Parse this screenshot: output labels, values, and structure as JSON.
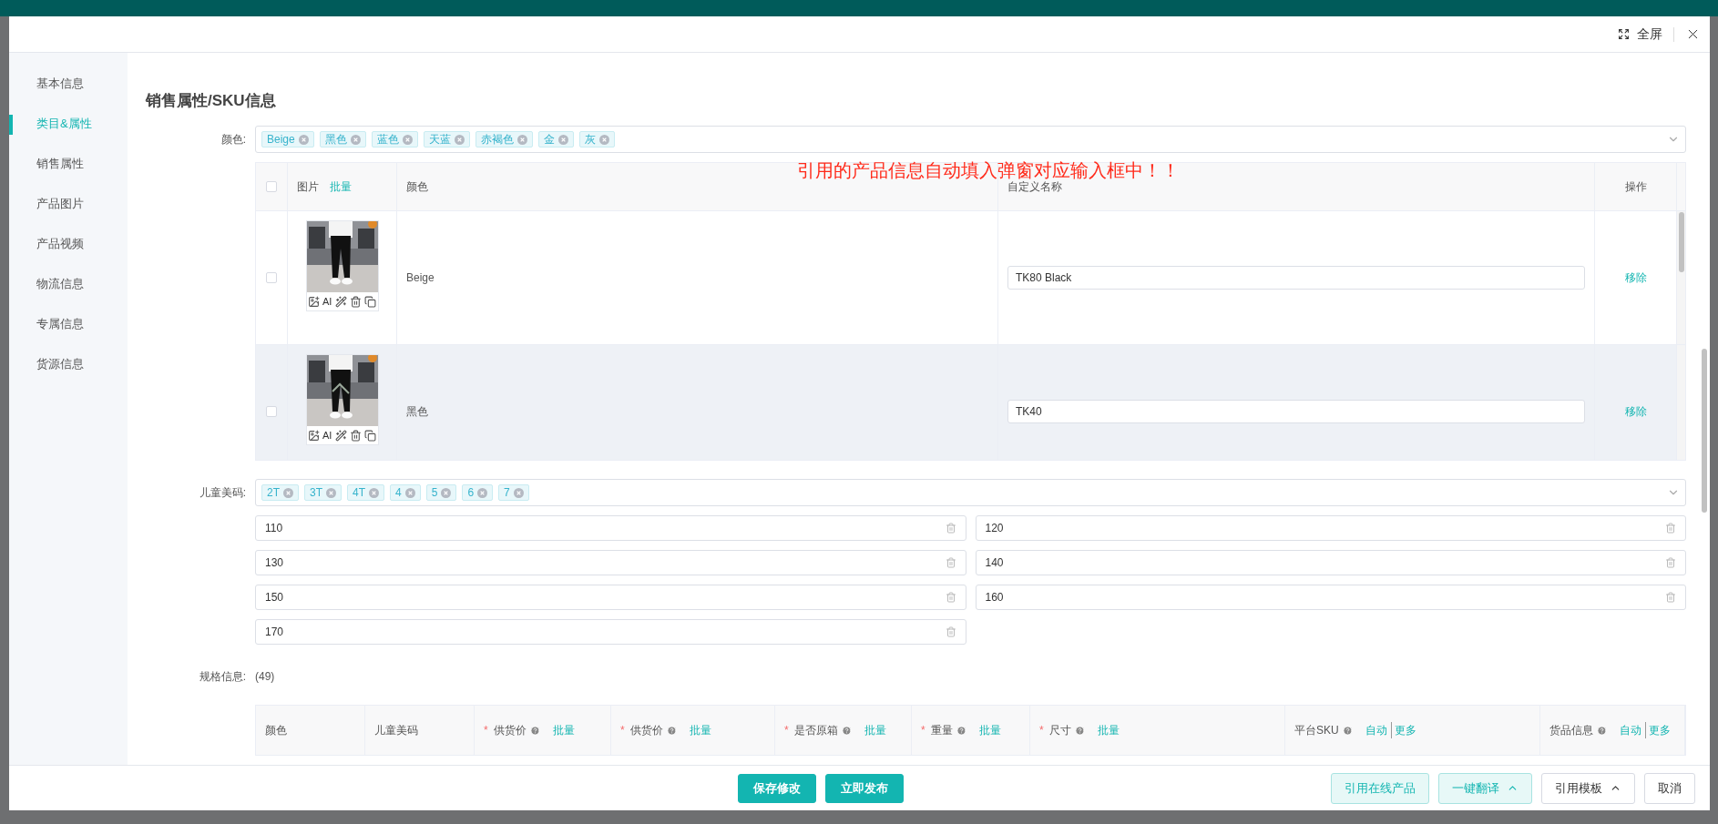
{
  "dialog": {
    "fullscreen_label": "全屏"
  },
  "sidebar": {
    "items": [
      {
        "label": "基本信息",
        "selected": false
      },
      {
        "label": "类目&属性",
        "selected": true
      },
      {
        "label": "销售属性",
        "selected": false
      },
      {
        "label": "产品图片",
        "selected": false
      },
      {
        "label": "产品视频",
        "selected": false
      },
      {
        "label": "物流信息",
        "selected": false
      },
      {
        "label": "专属信息",
        "selected": false
      },
      {
        "label": "货源信息",
        "selected": false
      }
    ]
  },
  "section_title": "销售属性/SKU信息",
  "annotation": "引用的产品信息自动填入弹窗对应输入框中！！",
  "color_field": {
    "label": "颜色:",
    "tags": [
      "Beige",
      "黑色",
      "蓝色",
      "天蓝",
      "赤褐色",
      "金",
      "灰"
    ]
  },
  "color_table": {
    "all_checked": false,
    "image_column": "图片",
    "batch_link": "批量",
    "color_column": "颜色",
    "name_column": "自定义名称",
    "action_column": "操作",
    "rows": [
      {
        "checked": false,
        "ai_label": "AI",
        "color_value": "Beige",
        "custom_name": "TK80 Black",
        "action": "移除",
        "selected": false
      },
      {
        "checked": false,
        "ai_label": "AI",
        "color_value": "黑色",
        "custom_name": "TK40",
        "action": "移除",
        "selected": true
      }
    ]
  },
  "kids_size": {
    "label": "儿童美码:",
    "tags": [
      "2T",
      "3T",
      "4T",
      "4",
      "5",
      "6",
      "7"
    ],
    "values": [
      "110",
      "120",
      "130",
      "140",
      "150",
      "160",
      "170"
    ]
  },
  "spec": {
    "label": "规格信息:",
    "count": "(49)",
    "columns": [
      {
        "label": "颜色",
        "required": false,
        "help": false
      },
      {
        "label": "儿童美码",
        "required": false,
        "help": false
      },
      {
        "label": "供货价",
        "required": true,
        "help": true,
        "links": [
          "批量"
        ]
      },
      {
        "label": "供货价",
        "required": true,
        "help": true,
        "links": [
          "批量"
        ]
      },
      {
        "label": "是否原箱",
        "required": true,
        "help": true,
        "links": [
          "批量"
        ]
      },
      {
        "label": "重量",
        "required": true,
        "help": true,
        "links": [
          "批量"
        ]
      },
      {
        "label": "尺寸",
        "required": true,
        "help": true,
        "links": [
          "批量"
        ]
      },
      {
        "label": "平台SKU",
        "required": false,
        "help": true,
        "links": [
          "自动",
          "更多"
        ]
      },
      {
        "label": "货品信息",
        "required": false,
        "help": true,
        "links": [
          "自动",
          "更多"
        ]
      }
    ],
    "required_mark": "*"
  },
  "footer": {
    "center_buttons": [
      {
        "label": "保存修改",
        "kind": "primary",
        "caret": false
      },
      {
        "label": "立即发布",
        "kind": "primary",
        "caret": false
      }
    ],
    "right_buttons": [
      {
        "label": "引用在线产品",
        "kind": "light",
        "caret": false
      },
      {
        "label": "一键翻译",
        "kind": "light",
        "caret": true
      },
      {
        "label": "引用模板",
        "kind": "plain",
        "caret": true
      },
      {
        "label": "取消",
        "kind": "plain",
        "caret": false
      }
    ]
  }
}
